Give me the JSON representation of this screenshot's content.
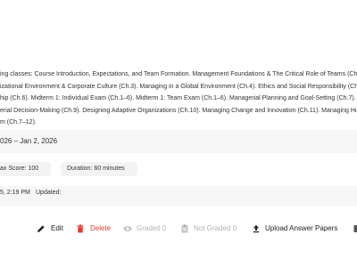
{
  "description": {
    "lines": [
      "ing classes: Course Introduction, Expectations, and Team Formation. Management Foundations & The Critical Role of Teams (Ch",
      "izational Environment & Corporate Culture (Ch.3). Managing in a Global Environment (Ch.4). Ethics and Social Responsibility (Ch",
      "hip (Ch.6). Midterm 1: Individual Exam (Ch.1–6). Midterm 1: Team Exam (Ch.1–6). Managerial Planning and Goal-Setting (Ch.7). S",
      "erial Decision-Making (Ch.9). Designing Adaptive Organizations (Ch.10). Managing Change and Innovation (Ch.11). Managing Hum",
      "m (Ch.7–12)."
    ]
  },
  "schedule": {
    "date_range": "026  –  Jan 2, 2026"
  },
  "details": {
    "max_score": "ax Score: 100",
    "duration": "Duration: 60 minutes"
  },
  "meta": {
    "created": "5, 2:19 PM",
    "updated": "Updated:"
  },
  "actions": {
    "edit": {
      "label": "Edit",
      "icon": "pencil-icon"
    },
    "delete": {
      "label": "Delete",
      "icon": "trash-icon",
      "color": "#e53935"
    },
    "graded": {
      "label": "Graded 0",
      "icon": "eye-icon"
    },
    "not_graded": {
      "label": "Not Graded 0",
      "icon": "clipboard-icon"
    },
    "upload": {
      "label": "Upload Answer Papers",
      "icon": "upload-icon"
    },
    "more": {
      "icon": "more-icon"
    }
  }
}
